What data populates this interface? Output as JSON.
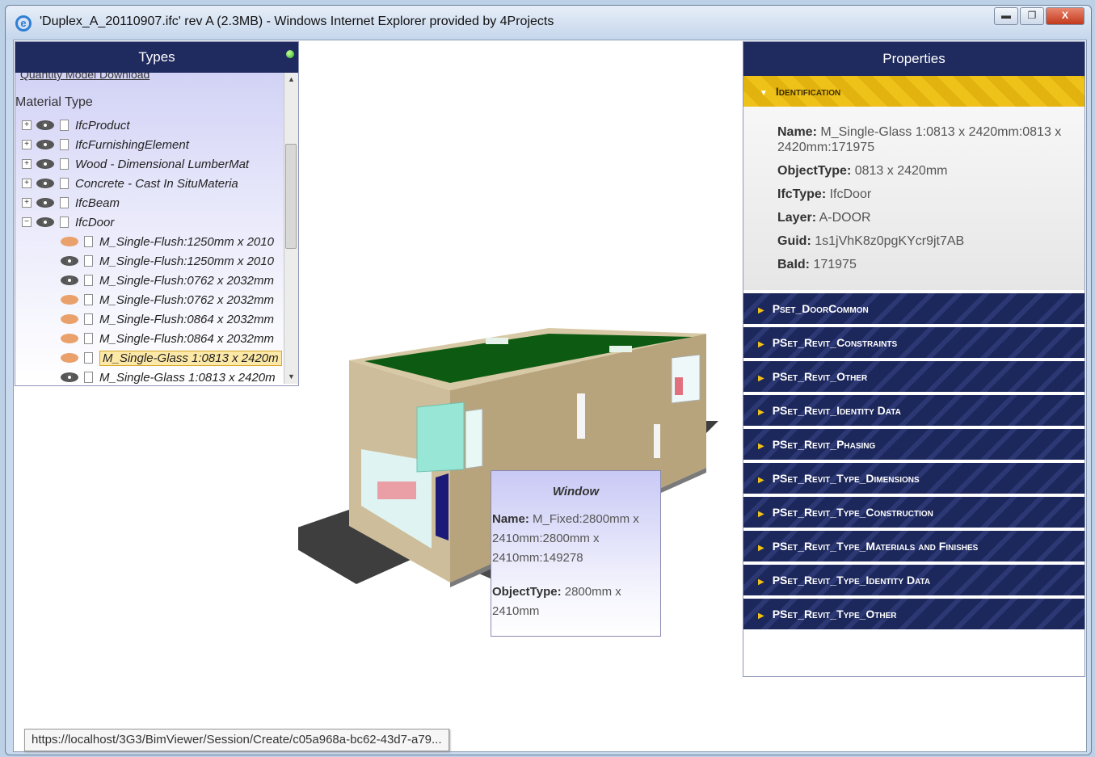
{
  "window": {
    "title": "'Duplex_A_20110907.ifc' rev A (2.3MB) - Windows Internet Explorer provided by 4Projects",
    "minimize_label": "▬",
    "maximize_label": "❐",
    "close_label": "X"
  },
  "types_panel": {
    "header": "Types",
    "cut_link": "Quantity Model Download",
    "material_type_label": "Material Type",
    "tree": [
      {
        "label": "IfcProduct",
        "expander": "+",
        "eye": "on"
      },
      {
        "label": "IfcFurnishingElement",
        "expander": "+",
        "eye": "on"
      },
      {
        "label": "Wood - Dimensional LumberMat",
        "expander": "+",
        "eye": "on"
      },
      {
        "label": "Concrete - Cast In SituMateria",
        "expander": "+",
        "eye": "on"
      },
      {
        "label": "IfcBeam",
        "expander": "+",
        "eye": "on"
      },
      {
        "label": "IfcDoor",
        "expander": "−",
        "eye": "on"
      },
      {
        "label": "M_Single-Flush:1250mm x 2010",
        "expander": "",
        "eye": "off"
      },
      {
        "label": "M_Single-Flush:1250mm x 2010",
        "expander": "",
        "eye": "on"
      },
      {
        "label": "M_Single-Flush:0762 x 2032mm",
        "expander": "",
        "eye": "on"
      },
      {
        "label": "M_Single-Flush:0762 x 2032mm",
        "expander": "",
        "eye": "off"
      },
      {
        "label": "M_Single-Flush:0864 x 2032mm",
        "expander": "",
        "eye": "off"
      },
      {
        "label": "M_Single-Flush:0864 x 2032mm",
        "expander": "",
        "eye": "off"
      },
      {
        "label": "M_Single-Glass 1:0813 x 2420m",
        "expander": "",
        "eye": "off",
        "selected": true
      },
      {
        "label": "M_Single-Glass 1:0813 x 2420m",
        "expander": "",
        "eye": "on"
      }
    ]
  },
  "properties_panel": {
    "header": "Properties",
    "identification": {
      "title": "Identification",
      "rows": [
        {
          "key": "Name:",
          "value": "M_Single-Glass 1:0813 x 2420mm:0813 x 2420mm:171975"
        },
        {
          "key": "ObjectType:",
          "value": "0813 x 2420mm"
        },
        {
          "key": "IfcType:",
          "value": "IfcDoor"
        },
        {
          "key": "Layer:",
          "value": "A-DOOR"
        },
        {
          "key": "Guid:",
          "value": "1s1jVhK8z0pgKYcr9jt7AB"
        },
        {
          "key": "BaId:",
          "value": "171975"
        }
      ]
    },
    "sections": [
      "Pset_DoorCommon",
      "PSet_Revit_Constraints",
      "PSet_Revit_Other",
      "PSet_Revit_Identity Data",
      "PSet_Revit_Phasing",
      "PSet_Revit_Type_Dimensions",
      "PSet_Revit_Type_Construction",
      "PSet_Revit_Type_Materials and Finishes",
      "PSet_Revit_Type_Identity Data",
      "PSet_Revit_Type_Other"
    ]
  },
  "tooltip": {
    "title": "Window",
    "name_key": "Name:",
    "name_value": "M_Fixed:2800mm x 2410mm:2800mm x 2410mm:149278",
    "type_key": "ObjectType:",
    "type_value": "2800mm x 2410mm"
  },
  "status_url": "https://localhost/3G3/BimViewer/Session/Create/c05a968a-bc62-43d7-a79...",
  "colors": {
    "panel_header": "#1f2a5e",
    "identification_header": "#efc21a",
    "roof": "#0d5a12",
    "walls": "#bfae8a"
  }
}
